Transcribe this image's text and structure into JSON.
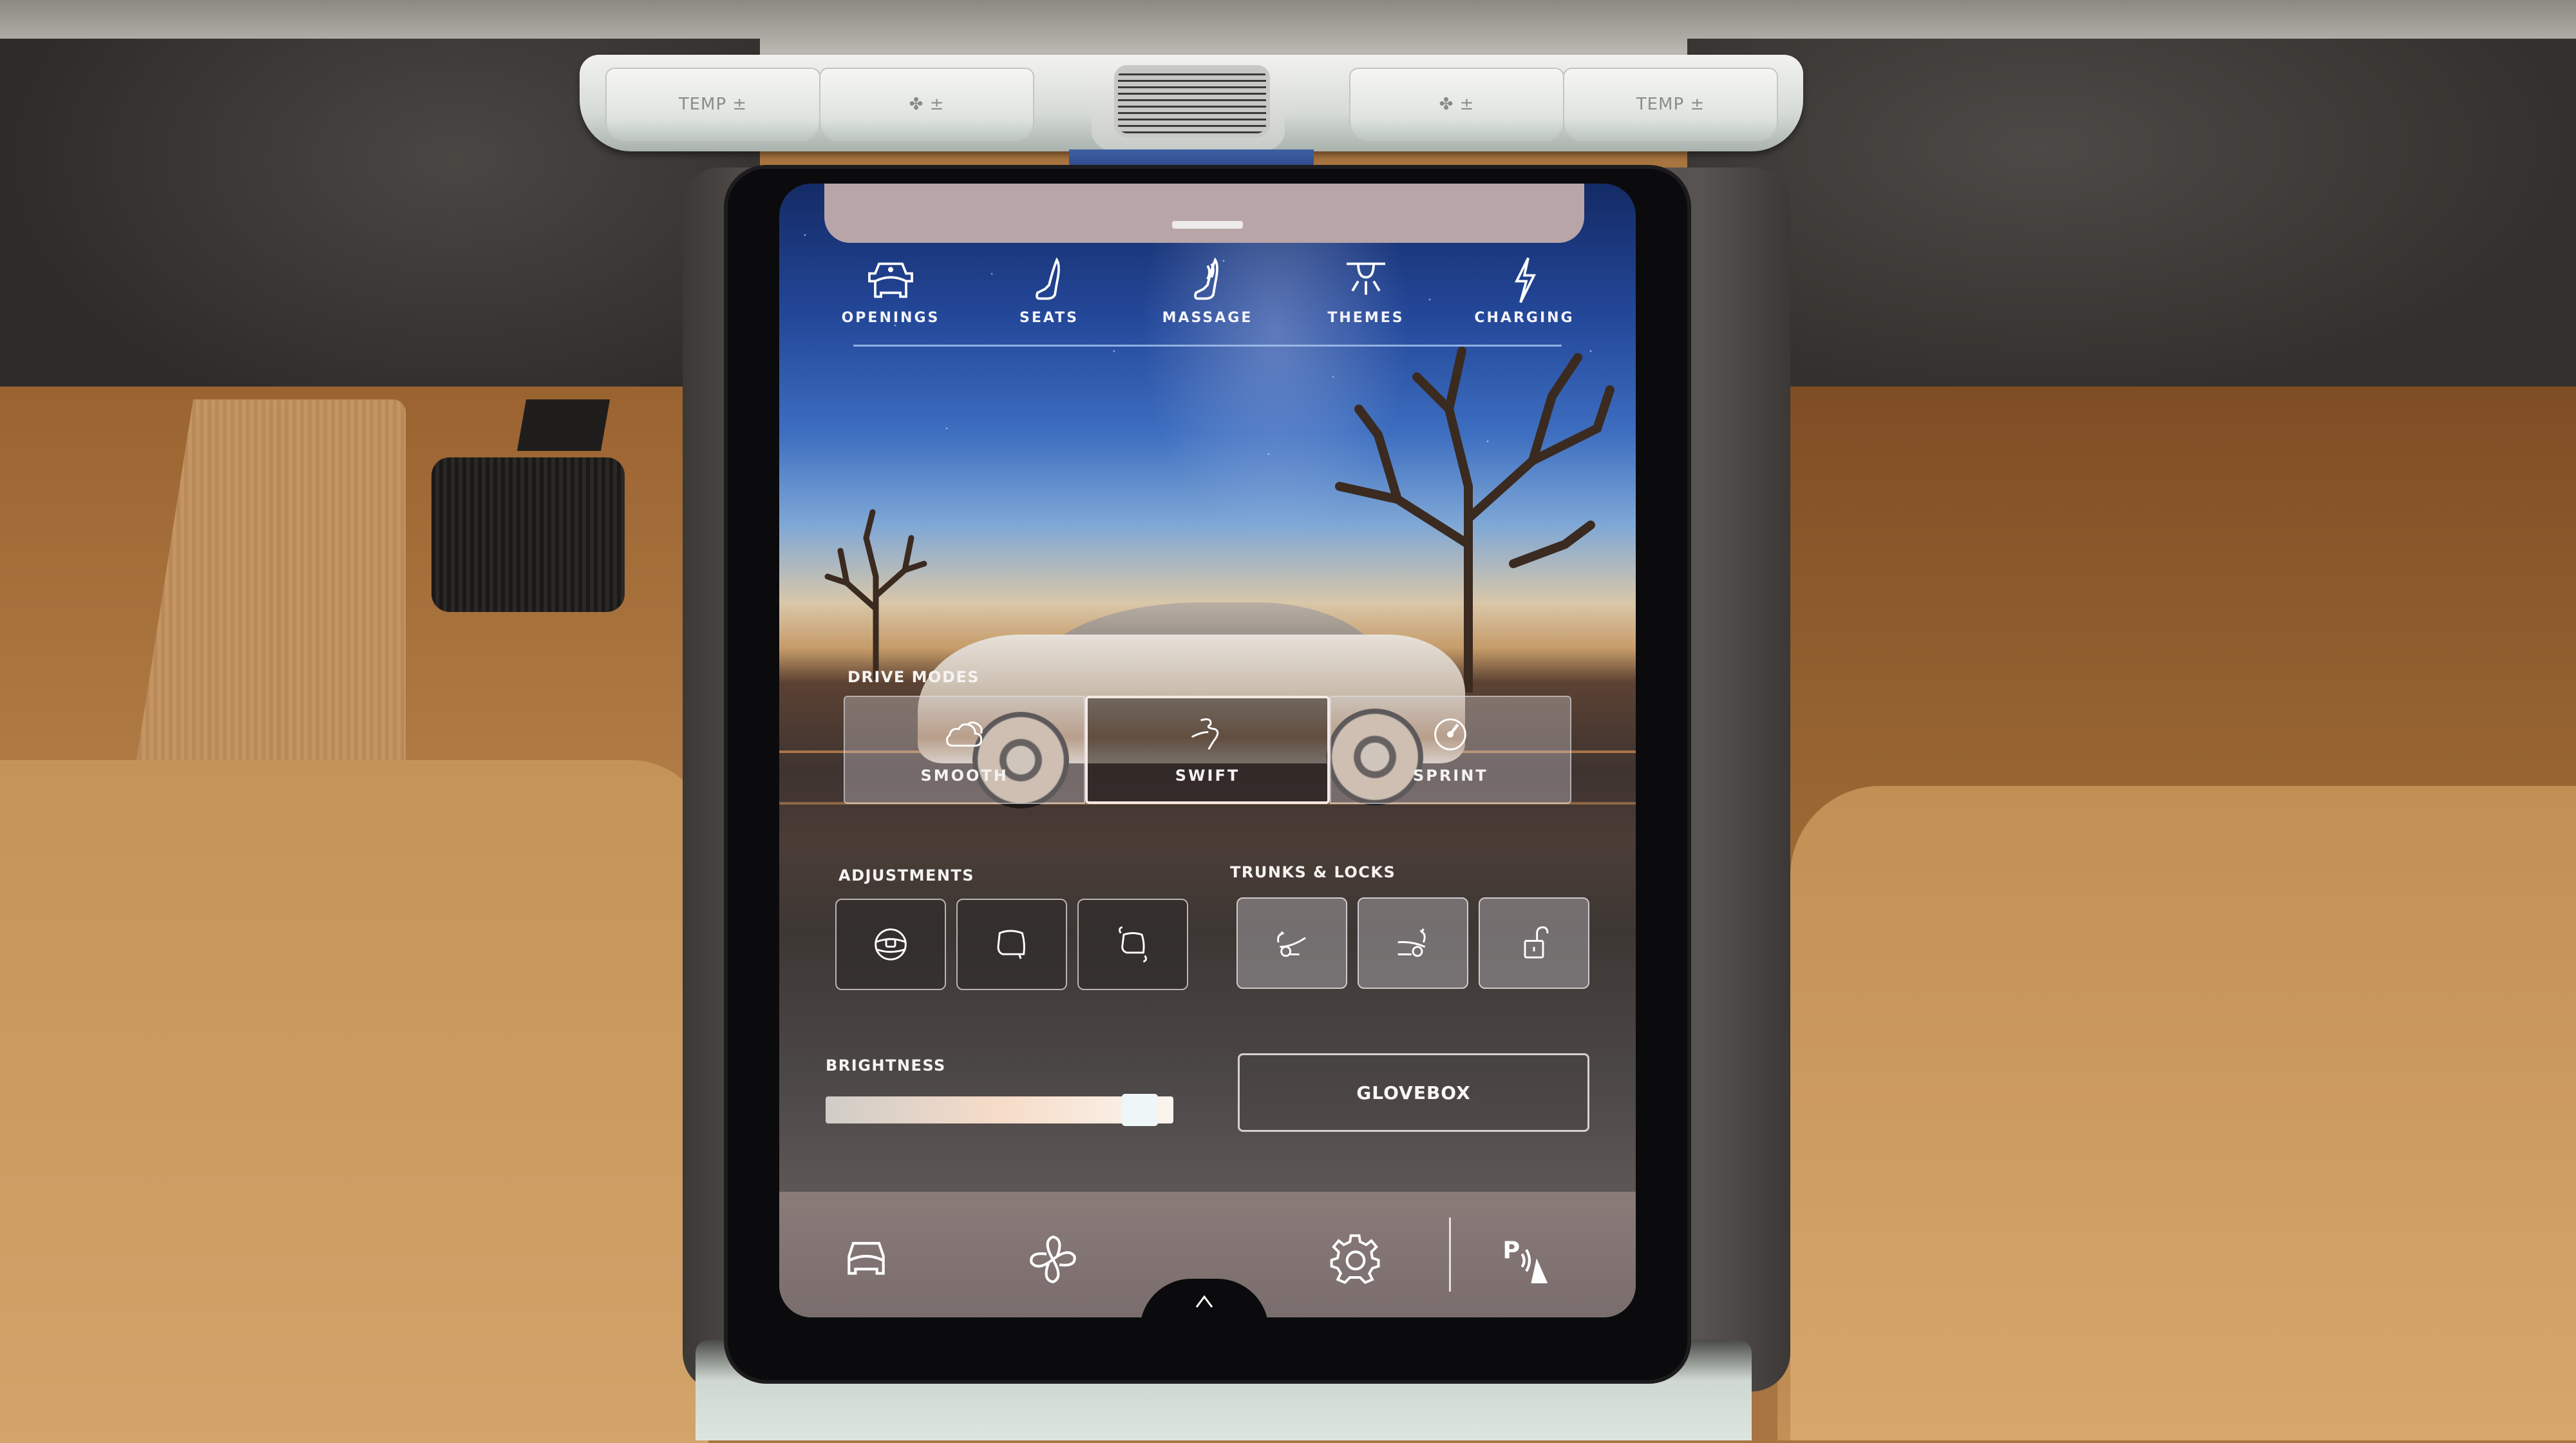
{
  "hvac_controls": {
    "left_temp": "TEMP ±",
    "left_fan": "✤ ±",
    "right_fan": "✤ ±",
    "right_temp": "TEMP ±"
  },
  "quick_actions": [
    {
      "label": "OPENINGS",
      "icon": "car-openings-icon"
    },
    {
      "label": "SEATS",
      "icon": "seat-icon"
    },
    {
      "label": "MASSAGE",
      "icon": "massage-seat-icon"
    },
    {
      "label": "THEMES",
      "icon": "cabin-light-icon"
    },
    {
      "label": "CHARGING",
      "icon": "lightning-bolt-icon"
    }
  ],
  "drive_modes": {
    "title": "DRIVE MODES",
    "options": [
      {
        "label": "SMOOTH",
        "icon": "cloud-icon",
        "selected": false
      },
      {
        "label": "SWIFT",
        "icon": "winding-road-icon",
        "selected": true
      },
      {
        "label": "SPRINT",
        "icon": "speedometer-icon",
        "selected": false
      }
    ]
  },
  "adjustments": {
    "title": "ADJUSTMENTS",
    "items": [
      {
        "icon": "steering-wheel-icon"
      },
      {
        "icon": "mirror-icon"
      },
      {
        "icon": "mirror-fold-icon"
      }
    ]
  },
  "trunks_locks": {
    "title": "TRUNKS & LOCKS",
    "items": [
      {
        "icon": "frunk-open-icon"
      },
      {
        "icon": "trunk-open-icon"
      },
      {
        "icon": "unlock-icon"
      }
    ]
  },
  "brightness": {
    "title": "BRIGHTNESS",
    "value_percent": 95
  },
  "glovebox": {
    "label": "GLOVEBOX"
  },
  "dock": [
    {
      "icon": "car-icon"
    },
    {
      "icon": "fan-icon"
    },
    {
      "icon": "settings-gear-icon"
    },
    {
      "icon": "park-assist-icon",
      "text": "P"
    }
  ]
}
